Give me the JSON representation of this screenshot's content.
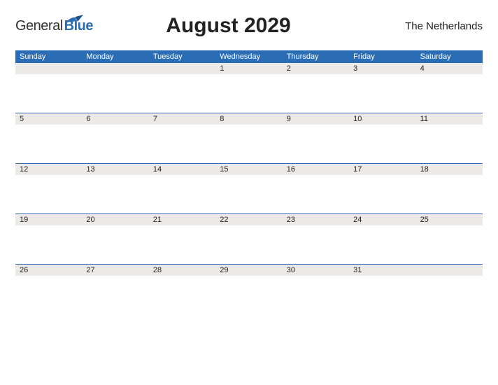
{
  "header": {
    "logo_general": "General",
    "logo_blue": "Blue",
    "title": "August 2029",
    "country": "The Netherlands"
  },
  "calendar": {
    "day_names": [
      "Sunday",
      "Monday",
      "Tuesday",
      "Wednesday",
      "Thursday",
      "Friday",
      "Saturday"
    ],
    "weeks": [
      [
        "",
        "",
        "",
        "1",
        "2",
        "3",
        "4"
      ],
      [
        "5",
        "6",
        "7",
        "8",
        "9",
        "10",
        "11"
      ],
      [
        "12",
        "13",
        "14",
        "15",
        "16",
        "17",
        "18"
      ],
      [
        "19",
        "20",
        "21",
        "22",
        "23",
        "24",
        "25"
      ],
      [
        "26",
        "27",
        "28",
        "29",
        "30",
        "31",
        ""
      ]
    ]
  }
}
